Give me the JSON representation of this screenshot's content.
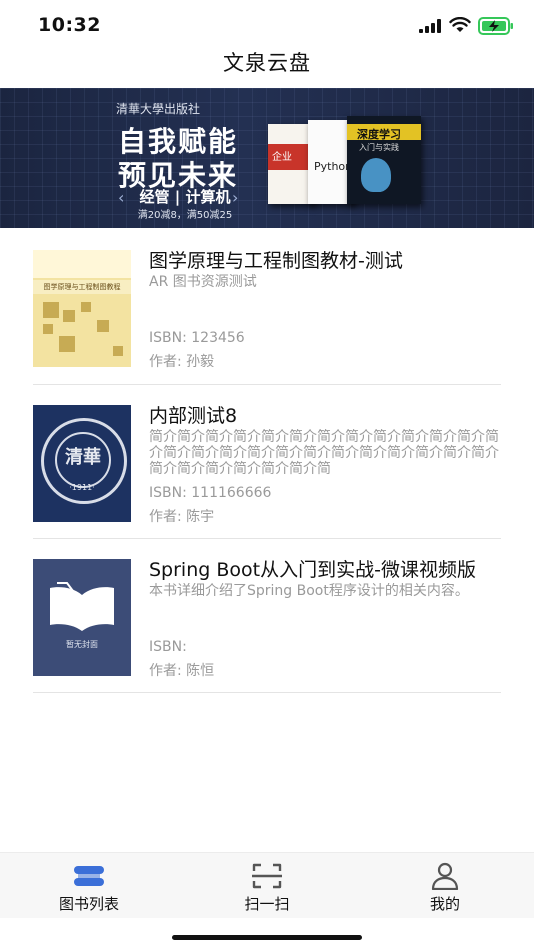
{
  "status": {
    "time": "10:32"
  },
  "nav": {
    "title": "文泉云盘"
  },
  "banner": {
    "publisher": "清華大學出版社",
    "headline_1": "自我赋能",
    "headline_2": "预见未来",
    "category": "经管 | 计算机",
    "promo": "满20减8，满50减25",
    "book_1": "企业",
    "book_2": "Python",
    "book_3_title": "深度学习",
    "book_3_sub": "入门与实践"
  },
  "books": [
    {
      "title": "图学原理与工程制图教材-测试",
      "description": "AR 图书资源测试",
      "isbn": "ISBN: 123456",
      "author": "作者: 孙毅",
      "cover_text": "图学原理与工程制图教程"
    },
    {
      "title": "内部测试8",
      "description": "简介简介简介简介简介简介简介简介简介简介简介简介简介简介简介简介简介简介简介简介简介简介简介简介简介简介简介简介简介简介简介简",
      "isbn": "ISBN: 111166666",
      "author": "作者: 陈宇",
      "cover_text": "清華",
      "cover_year": "·1911·"
    },
    {
      "title": "Spring Boot从入门到实战-微课视频版",
      "description": "本书详细介绍了Spring Boot程序设计的相关内容。",
      "isbn": "ISBN:",
      "author": "作者: 陈恒",
      "cover_text": "暂无封面"
    }
  ],
  "tabs": [
    {
      "label": "图书列表",
      "icon": "book-list-icon",
      "active": true
    },
    {
      "label": "扫一扫",
      "icon": "scan-icon",
      "active": false
    },
    {
      "label": "我的",
      "icon": "user-icon",
      "active": false
    }
  ],
  "colors": {
    "accent": "#3b6fd8",
    "muted_text": "#9a9a9a",
    "divider": "#e4e4e4"
  }
}
